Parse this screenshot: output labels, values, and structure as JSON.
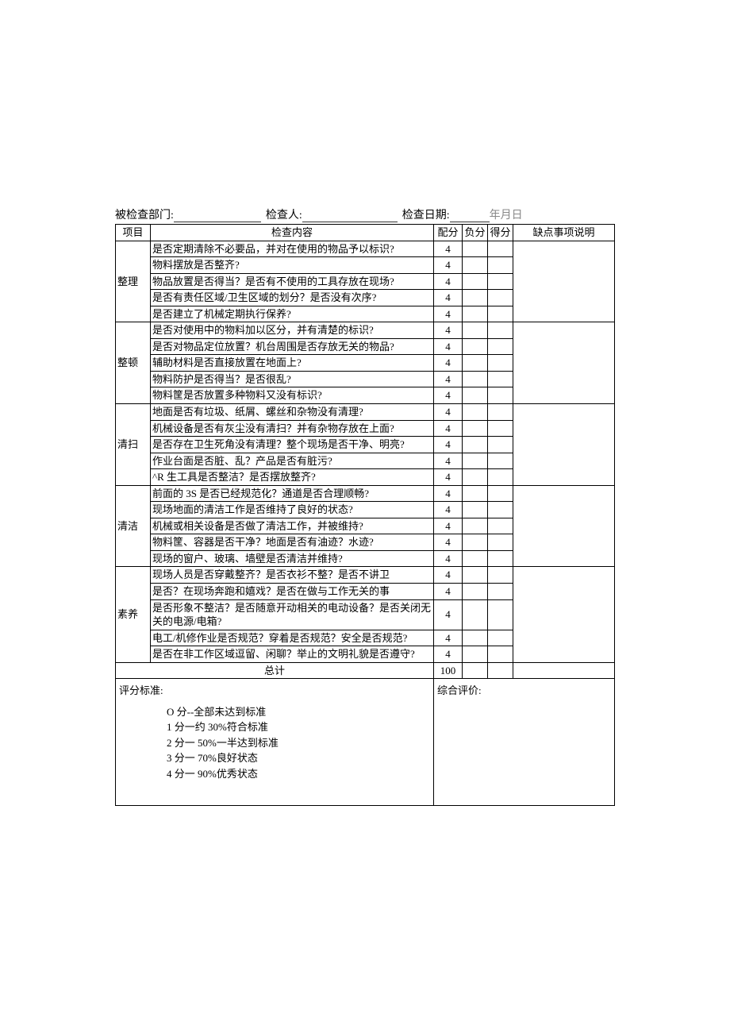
{
  "header": {
    "dept_label": "被检查部门:",
    "inspector_label": "检查人:",
    "date_label": "检查日期:",
    "date_value": "年月日"
  },
  "columns": {
    "category": "项目",
    "content": "检查内容",
    "assigned": "配分",
    "deduct": "负分",
    "score": "得分",
    "note": "缺点事项说明"
  },
  "sections": [
    {
      "name": "整理",
      "rows": [
        {
          "text": "是否定期清除不必要品，并对在使用的物品予以标识?",
          "score": "4"
        },
        {
          "text": "物料摆放是否整齐?",
          "score": "4"
        },
        {
          "text": "物品放置是否得当？是否有不使用的工具存放在现场?",
          "score": "4"
        },
        {
          "text": "是否有责任区域/卫生区域的划分？是否没有次序?",
          "score": "4"
        },
        {
          "text": "是否建立了机械定期执行保养?",
          "score": "4"
        }
      ]
    },
    {
      "name": "整顿",
      "rows": [
        {
          "text": "是否对使用中的物料加以区分，并有清楚的标识?",
          "score": "4"
        },
        {
          "text": "是否对物品定位放置？机台周围是否存放无关的物品?",
          "score": "4"
        },
        {
          "text": "辅助材料是否直接放置在地面上?",
          "score": "4"
        },
        {
          "text": "物料防护是否得当？是否很乱?",
          "score": "4"
        },
        {
          "text": "物料筐是否放置多种物料又没有标识?",
          "score": "4"
        }
      ]
    },
    {
      "name": "清扫",
      "rows": [
        {
          "text": "地面是否有垃圾、纸屑、螺丝和杂物没有清理?",
          "score": "4"
        },
        {
          "text": "机械设备是否有灰尘没有清扫？并有杂物存放在上面?",
          "score": "4"
        },
        {
          "text": "是否存在卫生死角没有清理？整个现场是否干净、明亮?",
          "score": "4"
        },
        {
          "text": "作业台面是否脏、乱？产品是否有脏污?",
          "score": "4"
        },
        {
          "text": "^R 生工具是否整洁？是否摆放整齐?",
          "score": "4"
        }
      ]
    },
    {
      "name": "清洁",
      "rows": [
        {
          "text": "前面的 3S 是否已经规范化？通道是否合理顺畅?",
          "score": "4"
        },
        {
          "text": "现场地面的清洁工作是否维持了良好的状态?",
          "score": "4"
        },
        {
          "text": "机械或相关设备是否做了清洁工作，并被维持?",
          "score": "4"
        },
        {
          "text": "物料筐、容器是否干净？地面是否有油迹？水迹?",
          "score": "4"
        },
        {
          "text": "现场的窗户、玻璃、墙壁是否清洁并维持?",
          "score": "4"
        }
      ]
    },
    {
      "name": "素养",
      "rows": [
        {
          "text": "现场人员是否穿戴整齐？是否衣衫不整？是否不讲卫",
          "score": "4"
        },
        {
          "text": "是否？在现场奔跑和嬉戏？是否在做与工作无关的事",
          "score": "4"
        },
        {
          "text": "是否形象不整洁？是否随意开动相关的电动设备？是否关闭无关的电源/电箱?",
          "score": "4"
        },
        {
          "text": "电工/机修作业是否规范？穿着是否规范？安全是否规范?",
          "score": "4"
        },
        {
          "text": "是否在非工作区域逗留、闲聊？举止的文明礼貌是否遵守?",
          "score": "4"
        }
      ]
    }
  ],
  "total": {
    "label": "总计",
    "value": "100"
  },
  "criteria": {
    "label": "评分标准:",
    "lines": [
      "O 分--全部未达到标准",
      "1 分一约 30%符合标准",
      "2 分一 50%一半达到标准",
      "3 分一 70%良好状态",
      "4 分一 90%优秀状态"
    ]
  },
  "evaluation_label": "综合评价:"
}
